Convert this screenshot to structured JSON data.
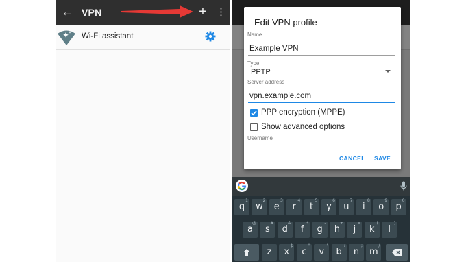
{
  "left": {
    "appbar": {
      "title": "VPN",
      "back_icon": "arrow-back-icon",
      "add_label": "+",
      "more_icon": "more-vert-icon"
    },
    "wifi_assistant": {
      "label": "Wi-Fi assistant",
      "settings_icon": "gear-icon"
    }
  },
  "dialog": {
    "title": "Edit VPN profile",
    "name_caption": "Name",
    "name_value": "Example VPN",
    "type_caption": "Type",
    "type_value": "PPTP",
    "server_caption": "Server address",
    "server_value": "vpn.example.com",
    "ppp_label": "PPP encryption (MPPE)",
    "ppp_checked": true,
    "advanced_label": "Show advanced options",
    "advanced_checked": false,
    "username_caption": "Username",
    "cancel_label": "CANCEL",
    "save_label": "SAVE"
  },
  "keyboard": {
    "row1": [
      {
        "k": "q",
        "h": "1"
      },
      {
        "k": "w",
        "h": "2"
      },
      {
        "k": "e",
        "h": "3"
      },
      {
        "k": "r",
        "h": "4"
      },
      {
        "k": "t",
        "h": "5"
      },
      {
        "k": "y",
        "h": "6"
      },
      {
        "k": "u",
        "h": "7"
      },
      {
        "k": "i",
        "h": "8"
      },
      {
        "k": "o",
        "h": "9"
      },
      {
        "k": "p",
        "h": "0"
      }
    ],
    "row2": [
      {
        "k": "a",
        "h": "@"
      },
      {
        "k": "s",
        "h": "#"
      },
      {
        "k": "d",
        "h": "&"
      },
      {
        "k": "f",
        "h": "*"
      },
      {
        "k": "g",
        "h": "-"
      },
      {
        "k": "h",
        "h": "+"
      },
      {
        "k": "j",
        "h": "="
      },
      {
        "k": "k",
        "h": "("
      },
      {
        "k": "l",
        "h": ")"
      }
    ],
    "row3": [
      {
        "k": "z",
        "h": "_"
      },
      {
        "k": "x",
        "h": "$"
      },
      {
        "k": "c",
        "h": "\""
      },
      {
        "k": "v",
        "h": "'"
      },
      {
        "k": "b",
        "h": ":"
      },
      {
        "k": "n",
        "h": ";"
      },
      {
        "k": "m",
        "h": "/"
      }
    ],
    "shift_icon": "shift-icon",
    "backspace_icon": "backspace-icon",
    "google_icon": "google-g-icon",
    "mic_icon": "mic-icon"
  },
  "colors": {
    "accent": "#1e88e5",
    "appbar": "#2f2f2f",
    "annotation_arrow": "#e53935",
    "keyboard": "#263238"
  }
}
